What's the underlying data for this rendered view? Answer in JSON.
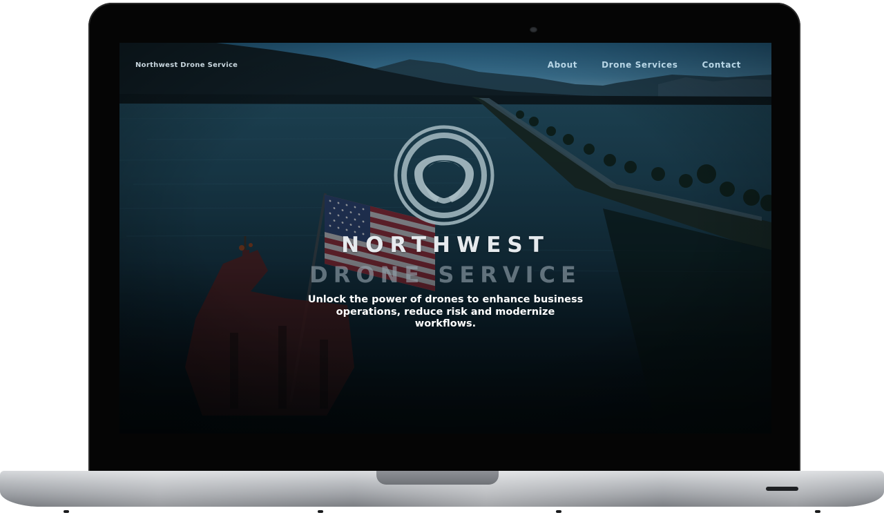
{
  "site": {
    "brand": "Northwest Drone Service",
    "nav": [
      {
        "label": "About"
      },
      {
        "label": "Drone Services"
      },
      {
        "label": "Contact"
      }
    ]
  },
  "hero": {
    "title_line_1": "NORTHWEST",
    "title_line_2": "DRONE SERVICE",
    "tagline": "Unlock the power of drones to enhance business operations, reduce risk and modernize workflows.",
    "logo": "circular-wings-emblem-icon"
  },
  "colors": {
    "bezel": "#050505",
    "nav_text": "#b8d6e6",
    "brand_text": "#c9d7df",
    "title": "#e6eaee",
    "water": "#1d3c4e",
    "sky": "#2f6f95"
  }
}
